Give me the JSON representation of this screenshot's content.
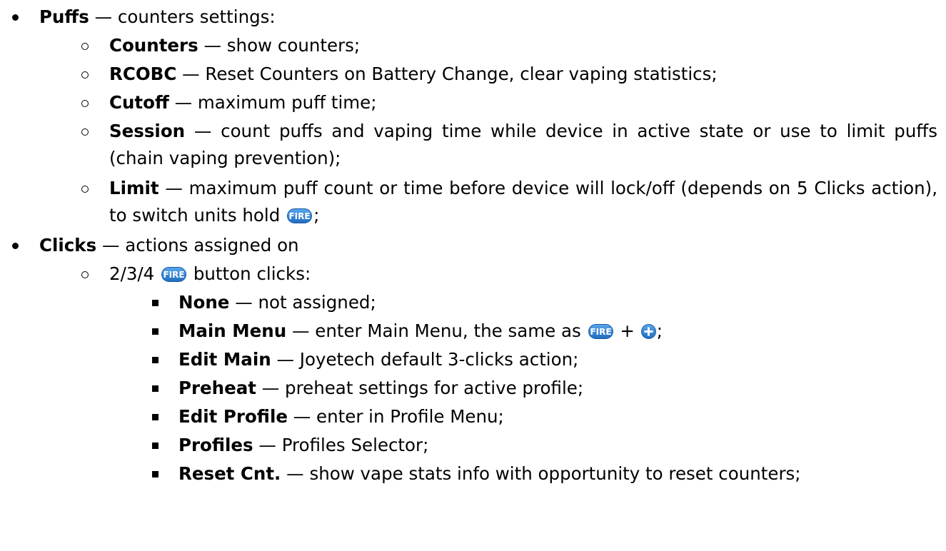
{
  "icons": {
    "fire_button": "fire-button-icon",
    "plus_button": "plus-button-icon",
    "accent": "#2f7fd0"
  },
  "puffs": {
    "term": "Puffs",
    "desc": " — counters settings:",
    "items": [
      {
        "term": "Counters",
        "desc": " — show counters;"
      },
      {
        "term": "RCOBC",
        "desc": " — Reset Counters on Battery Change, clear vaping statistics;"
      },
      {
        "term": "Cutoff",
        "desc": " — maximum puff time;"
      },
      {
        "term": "Session",
        "desc": " — count puffs and vaping time while device in active state or use to limit puffs (chain vaping prevention);"
      },
      {
        "term": "Limit",
        "desc": " — maximum puff count or time before device will lock/off (depends on 5 Clicks action), to switch units hold ",
        "desc_after": ";"
      }
    ]
  },
  "clicks": {
    "term": "Clicks",
    "desc": " — actions assigned on",
    "sub": {
      "prefix": "2/3/4 ",
      "suffix": " button clicks:",
      "items": [
        {
          "term": "None",
          "desc": " — not assigned;"
        },
        {
          "term": "Main Menu",
          "desc": " — enter Main Menu, the same as ",
          "join": " + ",
          "desc_after": ";"
        },
        {
          "term": "Edit Main",
          "desc": " — Joyetech default 3-clicks action;"
        },
        {
          "term": "Preheat",
          "desc": " — preheat settings for active profile;"
        },
        {
          "term": "Edit Profile",
          "desc": " — enter in Profile Menu;"
        },
        {
          "term": "Profiles",
          "desc": " — Profiles Selector;"
        },
        {
          "term": "Reset Cnt.",
          "desc": " — show vape stats info with opportunity to reset counters;"
        }
      ]
    }
  }
}
